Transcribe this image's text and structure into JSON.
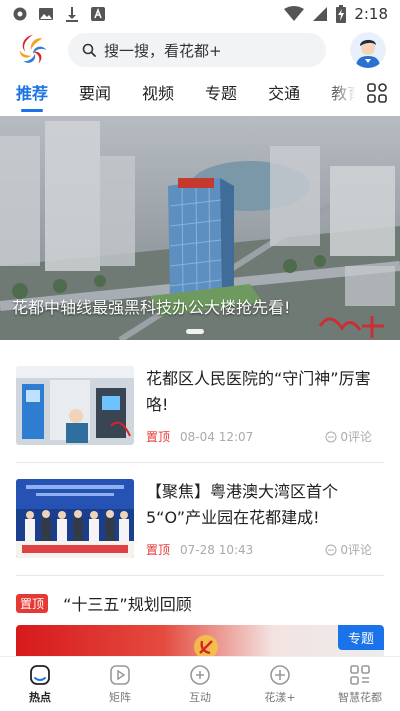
{
  "status_bar": {
    "time": "2:18",
    "icons": [
      "settings-icon",
      "image-icon",
      "download-icon",
      "text-badge-icon",
      "wifi-icon",
      "signal-icon",
      "battery-charging-icon"
    ]
  },
  "header": {
    "logo": "huadu-logo",
    "search_placeholder": "搜一搜，看花都+",
    "avatar": "user-avatar"
  },
  "tabs": {
    "items": [
      {
        "label": "推荐",
        "active": true
      },
      {
        "label": "要闻",
        "active": false
      },
      {
        "label": "视频",
        "active": false
      },
      {
        "label": "专题",
        "active": false
      },
      {
        "label": "交通",
        "active": false
      },
      {
        "label": "教育",
        "active": false
      }
    ],
    "grid_icon": "grid-menu-icon"
  },
  "banner": {
    "caption": "花都中轴线最强黑科技办公大楼抢先看!",
    "active_slide": 1
  },
  "news": [
    {
      "title": "花都区人民医院的“守门神”厉害咯!",
      "pin": "置顶",
      "date": "08-04 12:07",
      "comments": "0评论"
    },
    {
      "title": "【聚焦】粤港澳大湾区首个5“O”产业园在花都建成!",
      "pin": "置顶",
      "date": "07-28 10:43",
      "comments": "0评论"
    }
  ],
  "section": {
    "pin": "置顶",
    "title": "“十三五”规划回顾",
    "tag": "专题"
  },
  "bottom_nav": [
    {
      "label": "热点",
      "icon": "hot-icon",
      "active": true
    },
    {
      "label": "矩阵",
      "icon": "play-icon",
      "active": false
    },
    {
      "label": "互动",
      "icon": "interact-icon",
      "active": false
    },
    {
      "label": "花漾+",
      "icon": "plus-icon",
      "active": false
    },
    {
      "label": "智慧花都",
      "icon": "apps-icon",
      "active": false
    }
  ],
  "colors": {
    "accent": "#1a73e8",
    "pin_red": "#e53935"
  }
}
